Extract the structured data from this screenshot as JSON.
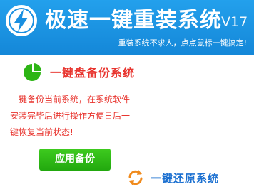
{
  "header": {
    "title": "极速一键重装系统",
    "version": "V17",
    "slogan": "重装系统不求人，点点鼠标一键搞定!"
  },
  "backup": {
    "title": "一键盘备份系统",
    "description_lines": [
      "一键备份当前系统，在系统软件",
      "安装完毕后进行操作方便日后一",
      "键恢复当前状态!"
    ],
    "button_label": "应用备份",
    "icon": "pie-chart-icon"
  },
  "restore": {
    "label": "一键还原系统",
    "icon": "refresh-icon"
  },
  "colors": {
    "header_bg": "#1a90e0",
    "accent_red": "#e8342e",
    "button_green": "#2db515",
    "link_blue": "#1a6fd0",
    "refresh_orange": "#f08a1c"
  }
}
